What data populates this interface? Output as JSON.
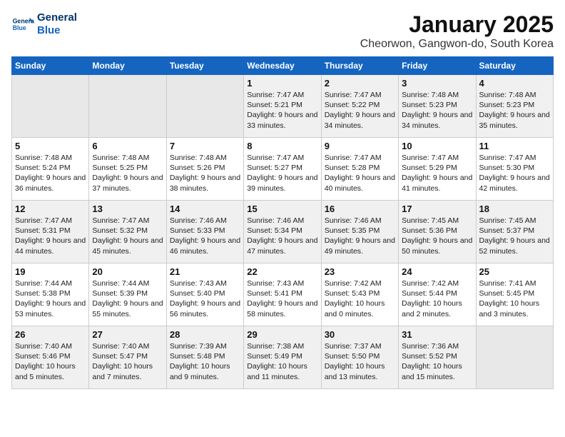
{
  "logo": {
    "line1": "General",
    "line2": "Blue"
  },
  "title": "January 2025",
  "subtitle": "Cheorwon, Gangwon-do, South Korea",
  "days_of_week": [
    "Sunday",
    "Monday",
    "Tuesday",
    "Wednesday",
    "Thursday",
    "Friday",
    "Saturday"
  ],
  "weeks": [
    [
      {
        "day": "",
        "info": ""
      },
      {
        "day": "",
        "info": ""
      },
      {
        "day": "",
        "info": ""
      },
      {
        "day": "1",
        "info": "Sunrise: 7:47 AM\nSunset: 5:21 PM\nDaylight: 9 hours and 33 minutes."
      },
      {
        "day": "2",
        "info": "Sunrise: 7:47 AM\nSunset: 5:22 PM\nDaylight: 9 hours and 34 minutes."
      },
      {
        "day": "3",
        "info": "Sunrise: 7:48 AM\nSunset: 5:23 PM\nDaylight: 9 hours and 34 minutes."
      },
      {
        "day": "4",
        "info": "Sunrise: 7:48 AM\nSunset: 5:23 PM\nDaylight: 9 hours and 35 minutes."
      }
    ],
    [
      {
        "day": "5",
        "info": "Sunrise: 7:48 AM\nSunset: 5:24 PM\nDaylight: 9 hours and 36 minutes."
      },
      {
        "day": "6",
        "info": "Sunrise: 7:48 AM\nSunset: 5:25 PM\nDaylight: 9 hours and 37 minutes."
      },
      {
        "day": "7",
        "info": "Sunrise: 7:48 AM\nSunset: 5:26 PM\nDaylight: 9 hours and 38 minutes."
      },
      {
        "day": "8",
        "info": "Sunrise: 7:47 AM\nSunset: 5:27 PM\nDaylight: 9 hours and 39 minutes."
      },
      {
        "day": "9",
        "info": "Sunrise: 7:47 AM\nSunset: 5:28 PM\nDaylight: 9 hours and 40 minutes."
      },
      {
        "day": "10",
        "info": "Sunrise: 7:47 AM\nSunset: 5:29 PM\nDaylight: 9 hours and 41 minutes."
      },
      {
        "day": "11",
        "info": "Sunrise: 7:47 AM\nSunset: 5:30 PM\nDaylight: 9 hours and 42 minutes."
      }
    ],
    [
      {
        "day": "12",
        "info": "Sunrise: 7:47 AM\nSunset: 5:31 PM\nDaylight: 9 hours and 44 minutes."
      },
      {
        "day": "13",
        "info": "Sunrise: 7:47 AM\nSunset: 5:32 PM\nDaylight: 9 hours and 45 minutes."
      },
      {
        "day": "14",
        "info": "Sunrise: 7:46 AM\nSunset: 5:33 PM\nDaylight: 9 hours and 46 minutes."
      },
      {
        "day": "15",
        "info": "Sunrise: 7:46 AM\nSunset: 5:34 PM\nDaylight: 9 hours and 47 minutes."
      },
      {
        "day": "16",
        "info": "Sunrise: 7:46 AM\nSunset: 5:35 PM\nDaylight: 9 hours and 49 minutes."
      },
      {
        "day": "17",
        "info": "Sunrise: 7:45 AM\nSunset: 5:36 PM\nDaylight: 9 hours and 50 minutes."
      },
      {
        "day": "18",
        "info": "Sunrise: 7:45 AM\nSunset: 5:37 PM\nDaylight: 9 hours and 52 minutes."
      }
    ],
    [
      {
        "day": "19",
        "info": "Sunrise: 7:44 AM\nSunset: 5:38 PM\nDaylight: 9 hours and 53 minutes."
      },
      {
        "day": "20",
        "info": "Sunrise: 7:44 AM\nSunset: 5:39 PM\nDaylight: 9 hours and 55 minutes."
      },
      {
        "day": "21",
        "info": "Sunrise: 7:43 AM\nSunset: 5:40 PM\nDaylight: 9 hours and 56 minutes."
      },
      {
        "day": "22",
        "info": "Sunrise: 7:43 AM\nSunset: 5:41 PM\nDaylight: 9 hours and 58 minutes."
      },
      {
        "day": "23",
        "info": "Sunrise: 7:42 AM\nSunset: 5:43 PM\nDaylight: 10 hours and 0 minutes."
      },
      {
        "day": "24",
        "info": "Sunrise: 7:42 AM\nSunset: 5:44 PM\nDaylight: 10 hours and 2 minutes."
      },
      {
        "day": "25",
        "info": "Sunrise: 7:41 AM\nSunset: 5:45 PM\nDaylight: 10 hours and 3 minutes."
      }
    ],
    [
      {
        "day": "26",
        "info": "Sunrise: 7:40 AM\nSunset: 5:46 PM\nDaylight: 10 hours and 5 minutes."
      },
      {
        "day": "27",
        "info": "Sunrise: 7:40 AM\nSunset: 5:47 PM\nDaylight: 10 hours and 7 minutes."
      },
      {
        "day": "28",
        "info": "Sunrise: 7:39 AM\nSunset: 5:48 PM\nDaylight: 10 hours and 9 minutes."
      },
      {
        "day": "29",
        "info": "Sunrise: 7:38 AM\nSunset: 5:49 PM\nDaylight: 10 hours and 11 minutes."
      },
      {
        "day": "30",
        "info": "Sunrise: 7:37 AM\nSunset: 5:50 PM\nDaylight: 10 hours and 13 minutes."
      },
      {
        "day": "31",
        "info": "Sunrise: 7:36 AM\nSunset: 5:52 PM\nDaylight: 10 hours and 15 minutes."
      },
      {
        "day": "",
        "info": ""
      }
    ]
  ]
}
